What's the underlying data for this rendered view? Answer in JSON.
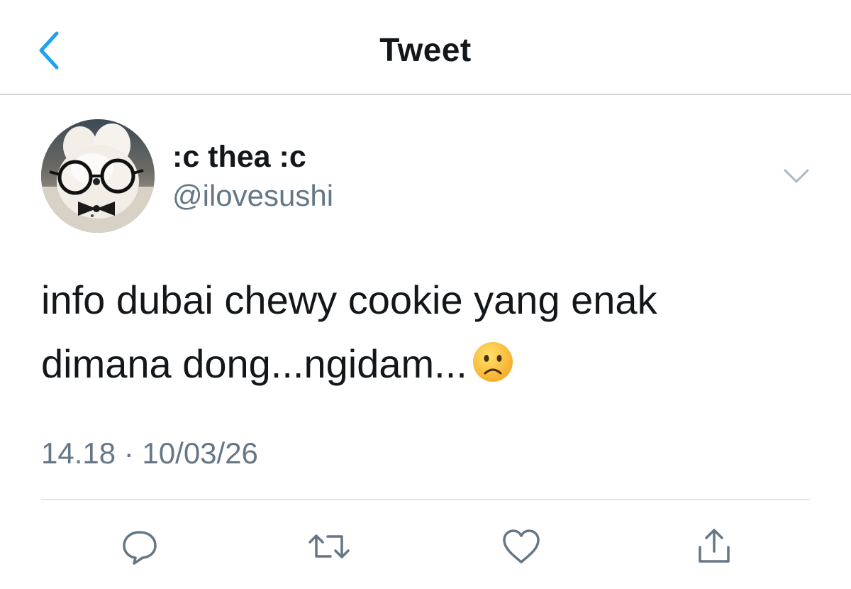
{
  "header": {
    "title": "Tweet",
    "back_icon": "chevron-left-icon",
    "accent_color": "#1da1f2"
  },
  "tweet": {
    "author": {
      "display_name": ":c thea :c",
      "handle": "@ilovesushi"
    },
    "text_lines": [
      "info dubai chewy cookie yang enak",
      "dimana dong...ngidam..."
    ],
    "emoji": "frowning-face-emoji",
    "timestamp": "14.18 · 10/03/26"
  },
  "actions": [
    {
      "name": "reply",
      "icon": "reply-icon"
    },
    {
      "name": "retweet",
      "icon": "retweet-icon"
    },
    {
      "name": "like",
      "icon": "heart-icon"
    },
    {
      "name": "share",
      "icon": "share-icon"
    }
  ],
  "colors": {
    "text": "#14171a",
    "secondary": "#657786",
    "icon_gray": "#657786"
  }
}
